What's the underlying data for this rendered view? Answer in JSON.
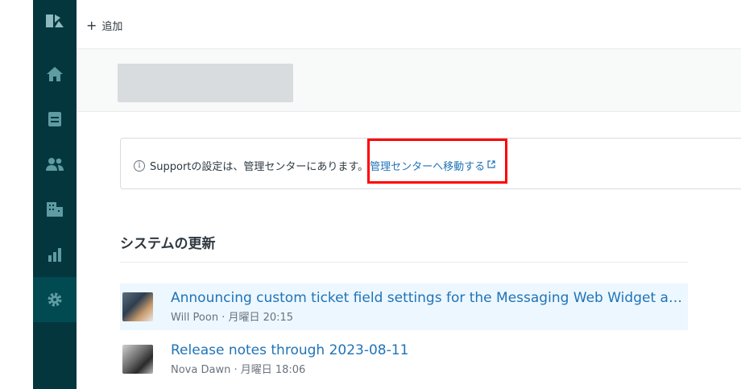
{
  "topbar": {
    "add_label": "追加"
  },
  "sidebar": {
    "items": [
      {
        "name": "home",
        "icon": "home-icon"
      },
      {
        "name": "views",
        "icon": "inbox-icon"
      },
      {
        "name": "customers",
        "icon": "people-icon"
      },
      {
        "name": "organizations",
        "icon": "building-icon"
      },
      {
        "name": "reporting",
        "icon": "bar-chart-icon"
      },
      {
        "name": "admin",
        "icon": "gear-icon",
        "active": true
      }
    ],
    "colors": {
      "background": "#03363d",
      "active": "#014a52",
      "icon": "#5f9ba2"
    }
  },
  "notice": {
    "text": "Supportの設定は、管理センターにあります。",
    "link_label": "管理センターへ移動する"
  },
  "system_updates": {
    "title": "システムの更新",
    "items": [
      {
        "title": "Announcing custom ticket field settings for the Messaging Web Widget and ...",
        "meta": "Will Poon · 月曜日 20:15"
      },
      {
        "title": "Release notes through 2023-08-11",
        "meta": "Nova Dawn · 月曜日 18:06"
      }
    ]
  },
  "colors": {
    "link": "#1f73b7",
    "highlight_box": "#ff0000",
    "selected_row": "#edf7ff"
  }
}
